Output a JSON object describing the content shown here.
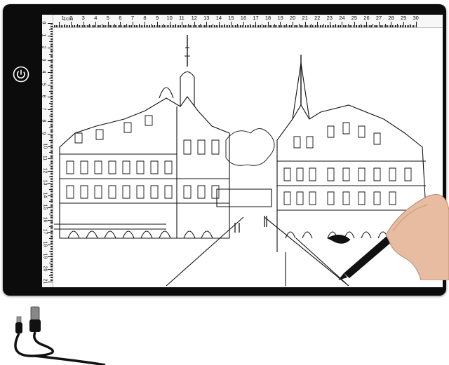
{
  "ruler": {
    "unit_label": "1cm",
    "top_numbers": [
      "0",
      "1",
      "2",
      "3",
      "4",
      "5",
      "6",
      "7",
      "8",
      "9",
      "10",
      "11",
      "12",
      "13",
      "14",
      "15",
      "16",
      "17",
      "18",
      "19",
      "20",
      "21",
      "22",
      "23",
      "24",
      "25",
      "26",
      "27",
      "28",
      "29",
      "30"
    ],
    "left_numbers": [
      "0",
      "1",
      "2",
      "3",
      "4",
      "5",
      "6",
      "7",
      "8",
      "9",
      "10",
      "11",
      "12",
      "13",
      "14",
      "15",
      "16",
      "17",
      "18",
      "19",
      "20",
      "21"
    ]
  },
  "icons": {
    "power": "power-icon",
    "cable": "usb-cable-icon",
    "pen": "pen-icon"
  },
  "colors": {
    "pad": "#0c0c0c",
    "surface": "#ffffff",
    "ink": "#111111",
    "skin": "#e7bca0"
  }
}
